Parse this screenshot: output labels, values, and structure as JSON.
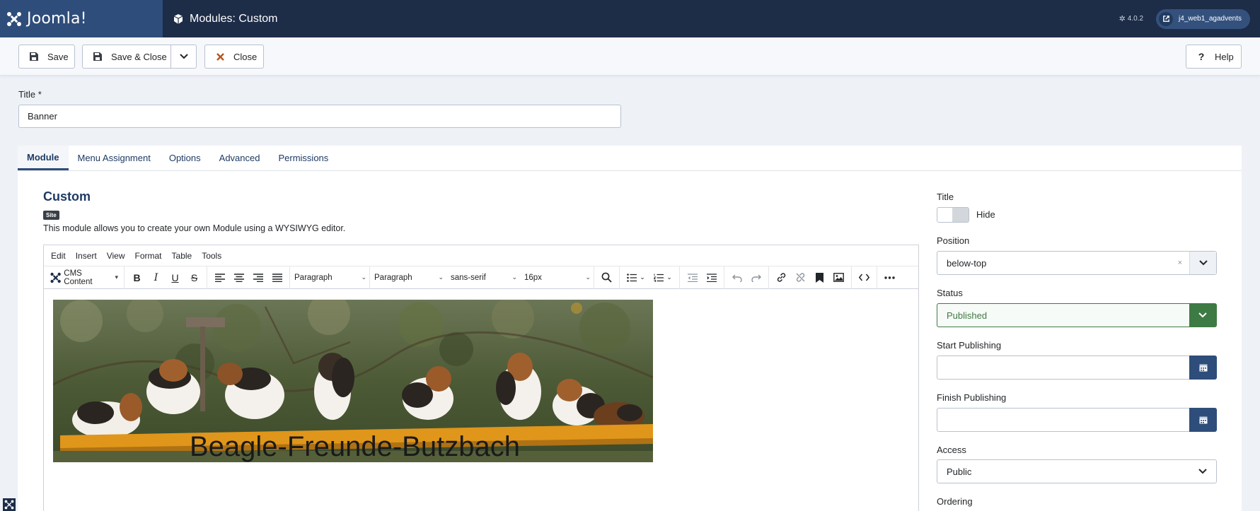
{
  "header": {
    "brand": "Joomla!",
    "title": "Modules: Custom",
    "version": "4.0.2",
    "site_name": "j4_web1_agadvents"
  },
  "toolbar": {
    "save": "Save",
    "save_close": "Save & Close",
    "close": "Close",
    "help": "Help"
  },
  "form": {
    "title_label": "Title *",
    "title_value": "Banner"
  },
  "tabs": [
    "Module",
    "Menu Assignment",
    "Options",
    "Advanced",
    "Permissions"
  ],
  "module": {
    "name": "Custom",
    "badge": "Site",
    "description": "This module allows you to create your own Module using a WYSIWYG editor."
  },
  "editor": {
    "menus": [
      "Edit",
      "Insert",
      "View",
      "Format",
      "Table",
      "Tools"
    ],
    "cms_content": "CMS Content",
    "block_format": "Paragraph",
    "style_format": "Paragraph",
    "font_family": "sans-serif",
    "font_size": "16px",
    "banner_caption": "Beagle-Freunde-Butzbach"
  },
  "sidebar": {
    "title_label": "Title",
    "title_toggle": "Hide",
    "position_label": "Position",
    "position_value": "below-top",
    "status_label": "Status",
    "status_value": "Published",
    "start_label": "Start Publishing",
    "finish_label": "Finish Publishing",
    "access_label": "Access",
    "access_value": "Public",
    "ordering_label": "Ordering"
  },
  "colors": {
    "header_bg": "#1d2c47",
    "brand_bg": "#2e4d7a",
    "status_green": "#3e7a44"
  }
}
